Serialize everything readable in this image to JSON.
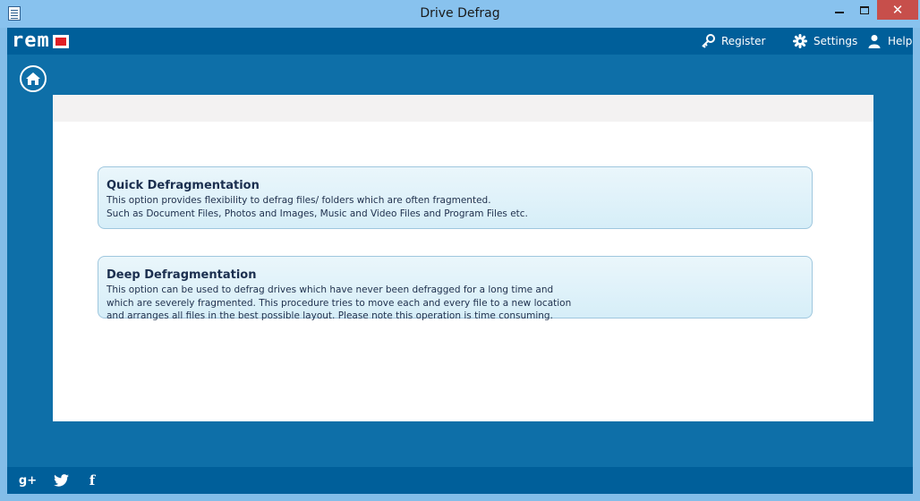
{
  "window": {
    "title": "Drive Defrag",
    "minimize": "",
    "maximize": "",
    "close": "✕"
  },
  "header": {
    "logo_text": "rem",
    "register": "Register",
    "settings": "Settings",
    "help": "Help"
  },
  "options": [
    {
      "title": "Quick Defragmentation",
      "lines": [
        "This option provides flexibility to defrag files/ folders which are often fragmented.",
        "Such as Document Files, Photos and Images, Music and Video Files and Program Files etc."
      ]
    },
    {
      "title": "Deep Defragmentation",
      "lines": [
        "This option can be used to defrag drives which have never been defragged for a long time and",
        "which are severely fragmented. This procedure tries to move each and every file to a new location",
        "and arranges all files in the best possible layout. Please note this operation is time consuming."
      ]
    }
  ],
  "footer": {
    "gplus": "g+",
    "facebook": "f"
  },
  "colors": {
    "titlebar": "#88c2ee",
    "frame": "#0e6fa8",
    "header": "#005f9a",
    "logo_accent": "#e01f26",
    "option_border": "#9fc7de"
  }
}
